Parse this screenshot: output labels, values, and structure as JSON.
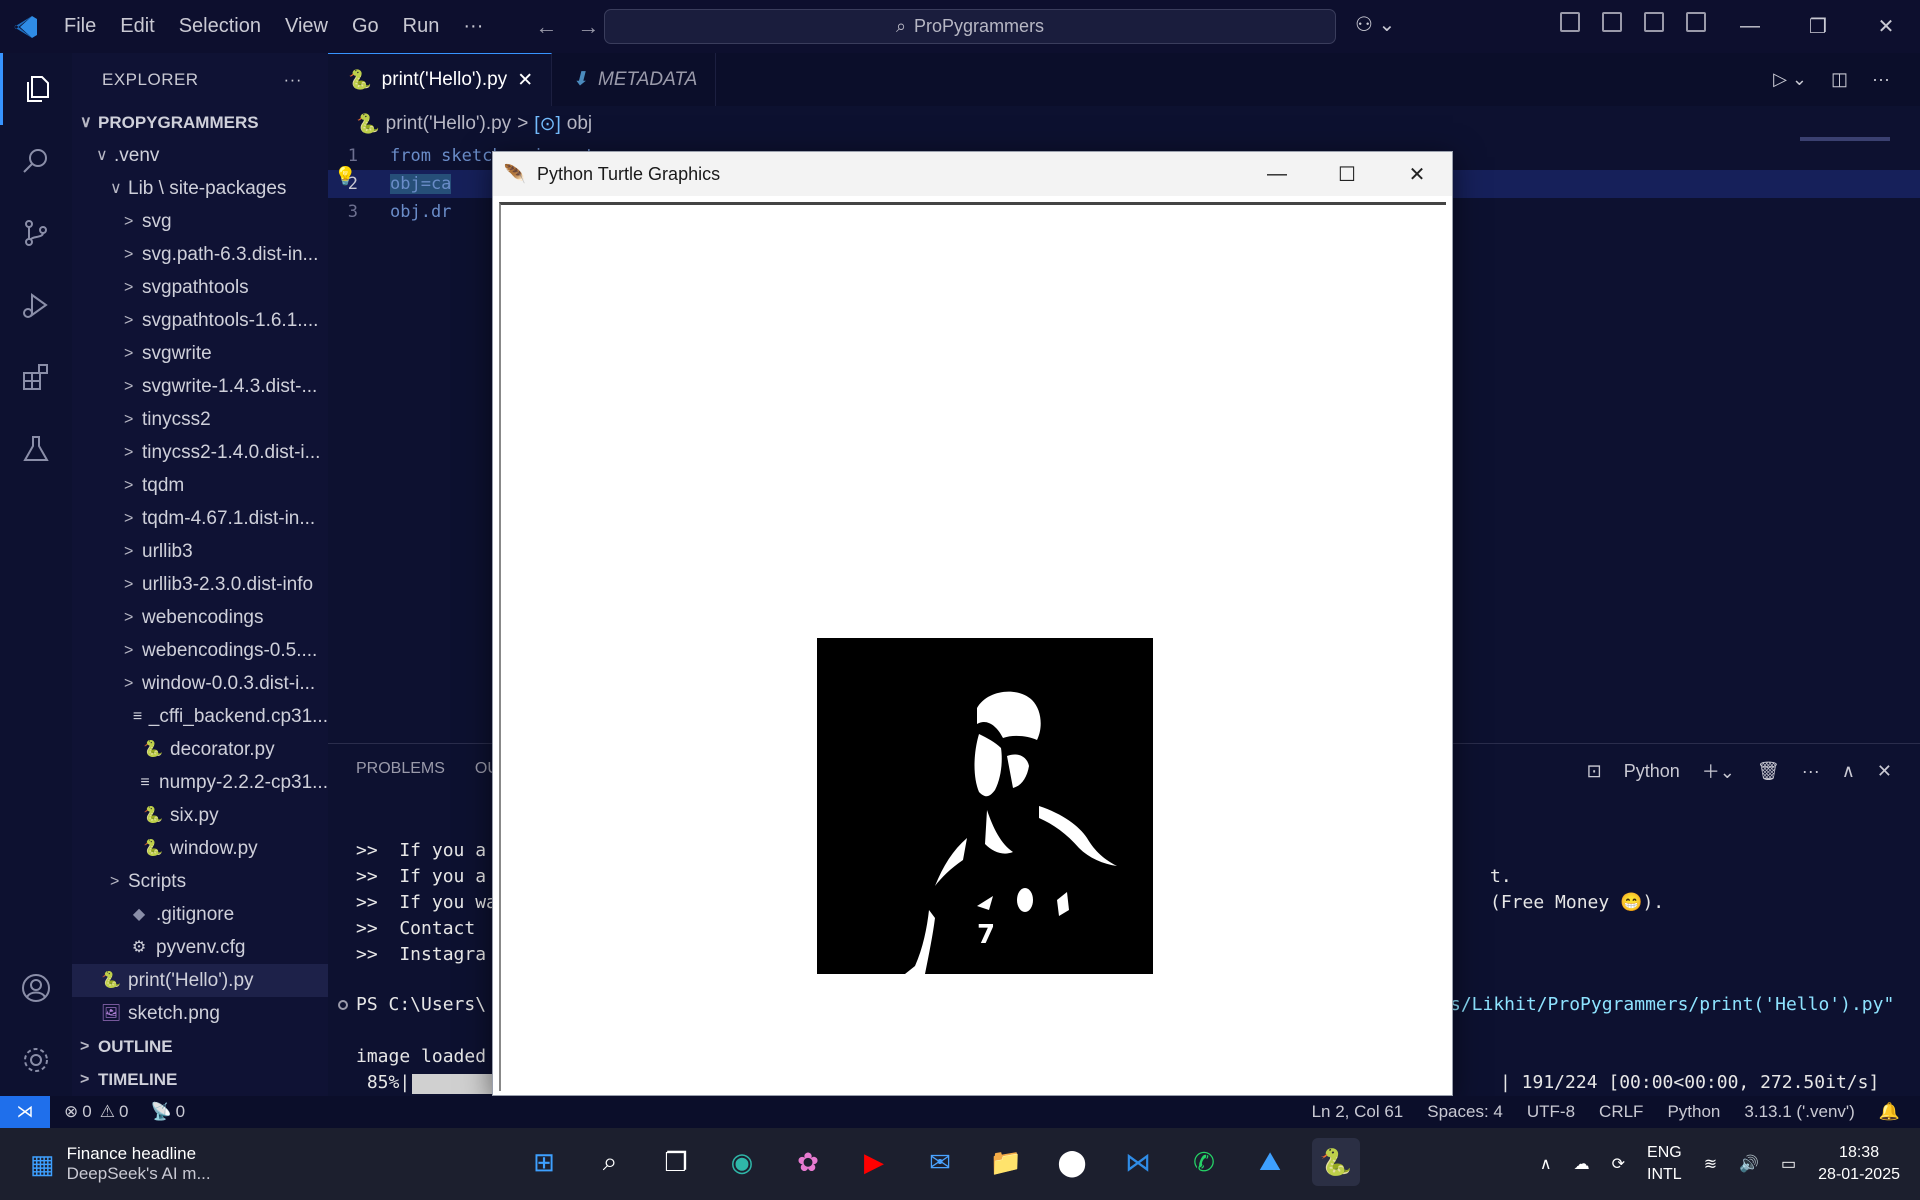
{
  "titlebar": {
    "menu": [
      "File",
      "Edit",
      "Selection",
      "View",
      "Go",
      "Run",
      "···"
    ],
    "search": "ProPygrammers"
  },
  "sidebar": {
    "title": "EXPLORER",
    "root": "PROPYGRAMMERS",
    "items": [
      {
        "label": ".venv",
        "chev": "∨",
        "indent": 24,
        "icon": ""
      },
      {
        "label": "Lib \\ site-packages",
        "chev": "∨",
        "indent": 38,
        "icon": ""
      },
      {
        "label": "svg",
        "chev": ">",
        "indent": 52,
        "icon": ""
      },
      {
        "label": "svg.path-6.3.dist-in...",
        "chev": ">",
        "indent": 52,
        "icon": ""
      },
      {
        "label": "svgpathtools",
        "chev": ">",
        "indent": 52,
        "icon": ""
      },
      {
        "label": "svgpathtools-1.6.1....",
        "chev": ">",
        "indent": 52,
        "icon": ""
      },
      {
        "label": "svgwrite",
        "chev": ">",
        "indent": 52,
        "icon": ""
      },
      {
        "label": "svgwrite-1.4.3.dist-...",
        "chev": ">",
        "indent": 52,
        "icon": ""
      },
      {
        "label": "tinycss2",
        "chev": ">",
        "indent": 52,
        "icon": ""
      },
      {
        "label": "tinycss2-1.4.0.dist-i...",
        "chev": ">",
        "indent": 52,
        "icon": ""
      },
      {
        "label": "tqdm",
        "chev": ">",
        "indent": 52,
        "icon": ""
      },
      {
        "label": "tqdm-4.67.1.dist-in...",
        "chev": ">",
        "indent": 52,
        "icon": ""
      },
      {
        "label": "urllib3",
        "chev": ">",
        "indent": 52,
        "icon": ""
      },
      {
        "label": "urllib3-2.3.0.dist-info",
        "chev": ">",
        "indent": 52,
        "icon": ""
      },
      {
        "label": "webencodings",
        "chev": ">",
        "indent": 52,
        "icon": ""
      },
      {
        "label": "webencodings-0.5....",
        "chev": ">",
        "indent": 52,
        "icon": ""
      },
      {
        "label": "window-0.0.3.dist-i...",
        "chev": ">",
        "indent": 52,
        "icon": ""
      },
      {
        "label": "_cffi_backend.cp31...",
        "chev": "",
        "indent": 52,
        "icon": "≡"
      },
      {
        "label": "decorator.py",
        "chev": "",
        "indent": 52,
        "icon": "py"
      },
      {
        "label": "numpy-2.2.2-cp31...",
        "chev": "",
        "indent": 52,
        "icon": "≡"
      },
      {
        "label": "six.py",
        "chev": "",
        "indent": 52,
        "icon": "py"
      },
      {
        "label": "window.py",
        "chev": "",
        "indent": 52,
        "icon": "py"
      },
      {
        "label": "Scripts",
        "chev": ">",
        "indent": 38,
        "icon": ""
      },
      {
        "label": ".gitignore",
        "chev": "",
        "indent": 38,
        "icon": "◆"
      },
      {
        "label": "pyvenv.cfg",
        "chev": "",
        "indent": 38,
        "icon": "⚙"
      },
      {
        "label": "print('Hello').py",
        "chev": "",
        "indent": 10,
        "icon": "py",
        "selected": true
      },
      {
        "label": "sketch.png",
        "chev": "",
        "indent": 10,
        "icon": "img"
      }
    ],
    "outline": "OUTLINE",
    "timeline": "TIMELINE"
  },
  "editor": {
    "tabs": [
      {
        "label": "print('Hello').py",
        "active": true
      },
      {
        "label": "METADATA",
        "active": false
      }
    ],
    "breadcrumb": {
      "file": "print('Hello').py",
      "symbol": "obj"
    },
    "lines": [
      {
        "num": "1",
        "text": "from sketchpy import canvas"
      },
      {
        "num": "2",
        "text": "obj=ca"
      },
      {
        "num": "3",
        "text": "obj.dr"
      }
    ]
  },
  "panel": {
    "tabs": [
      "PROBLEMS",
      "OU"
    ],
    "shell": "Python",
    "term": [
      ">>  If you a",
      ">>  If you a",
      ">>  If you wa",
      ">>  Contact",
      ">>  Instagra"
    ],
    "term_right": [
      "t.",
      "(Free Money 😁)."
    ],
    "prompt_left": "PS C:\\Users\\",
    "prompt_right": "s/Likhit/ProPygrammers/print('Hello').py\"",
    "image_loaded": "image loaded",
    "progress_left": " 85%|",
    "progress_right": "| 191/224 [00:00<00:00, 272.50it/s]"
  },
  "turtle": {
    "title": "Python Turtle Graphics"
  },
  "statusbar": {
    "errors": "0",
    "warnings": "0",
    "ports": "0",
    "position": "Ln 2, Col 61",
    "spaces": "Spaces: 4",
    "encoding": "UTF-8",
    "eol": "CRLF",
    "language": "Python",
    "interpreter": "3.13.1 ('.venv')"
  },
  "taskbar": {
    "news_title": "Finance headline",
    "news_sub": "DeepSeek's AI m...",
    "lang1": "ENG",
    "lang2": "INTL",
    "time": "18:38",
    "date": "28-01-2025"
  }
}
